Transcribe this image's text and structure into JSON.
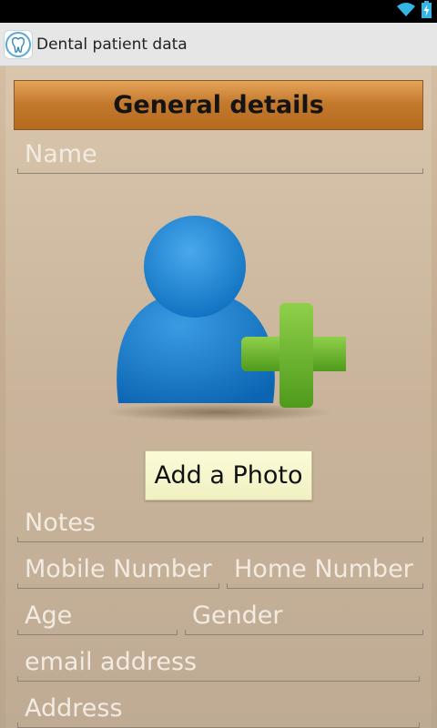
{
  "app": {
    "title": "Dental patient data",
    "icon": "tooth-icon"
  },
  "status_bar": {
    "icons": [
      "wifi-icon",
      "battery-charging-icon"
    ]
  },
  "colors": {
    "header_orange": "#c47a2d",
    "background_tan": "#c9b49b",
    "avatar_blue": "#1a7fcf",
    "plus_green": "#6fba2c",
    "button_cream": "#f4f2c8"
  },
  "section": {
    "title": "General details"
  },
  "form": {
    "name_placeholder": "Name",
    "add_photo_label": "Add a Photo",
    "notes_placeholder": "Notes",
    "mobile_placeholder": "Mobile Number",
    "home_placeholder": "Home Number",
    "age_placeholder": "Age",
    "gender_placeholder": "Gender",
    "email_placeholder": "email address",
    "address_placeholder": "Address"
  }
}
